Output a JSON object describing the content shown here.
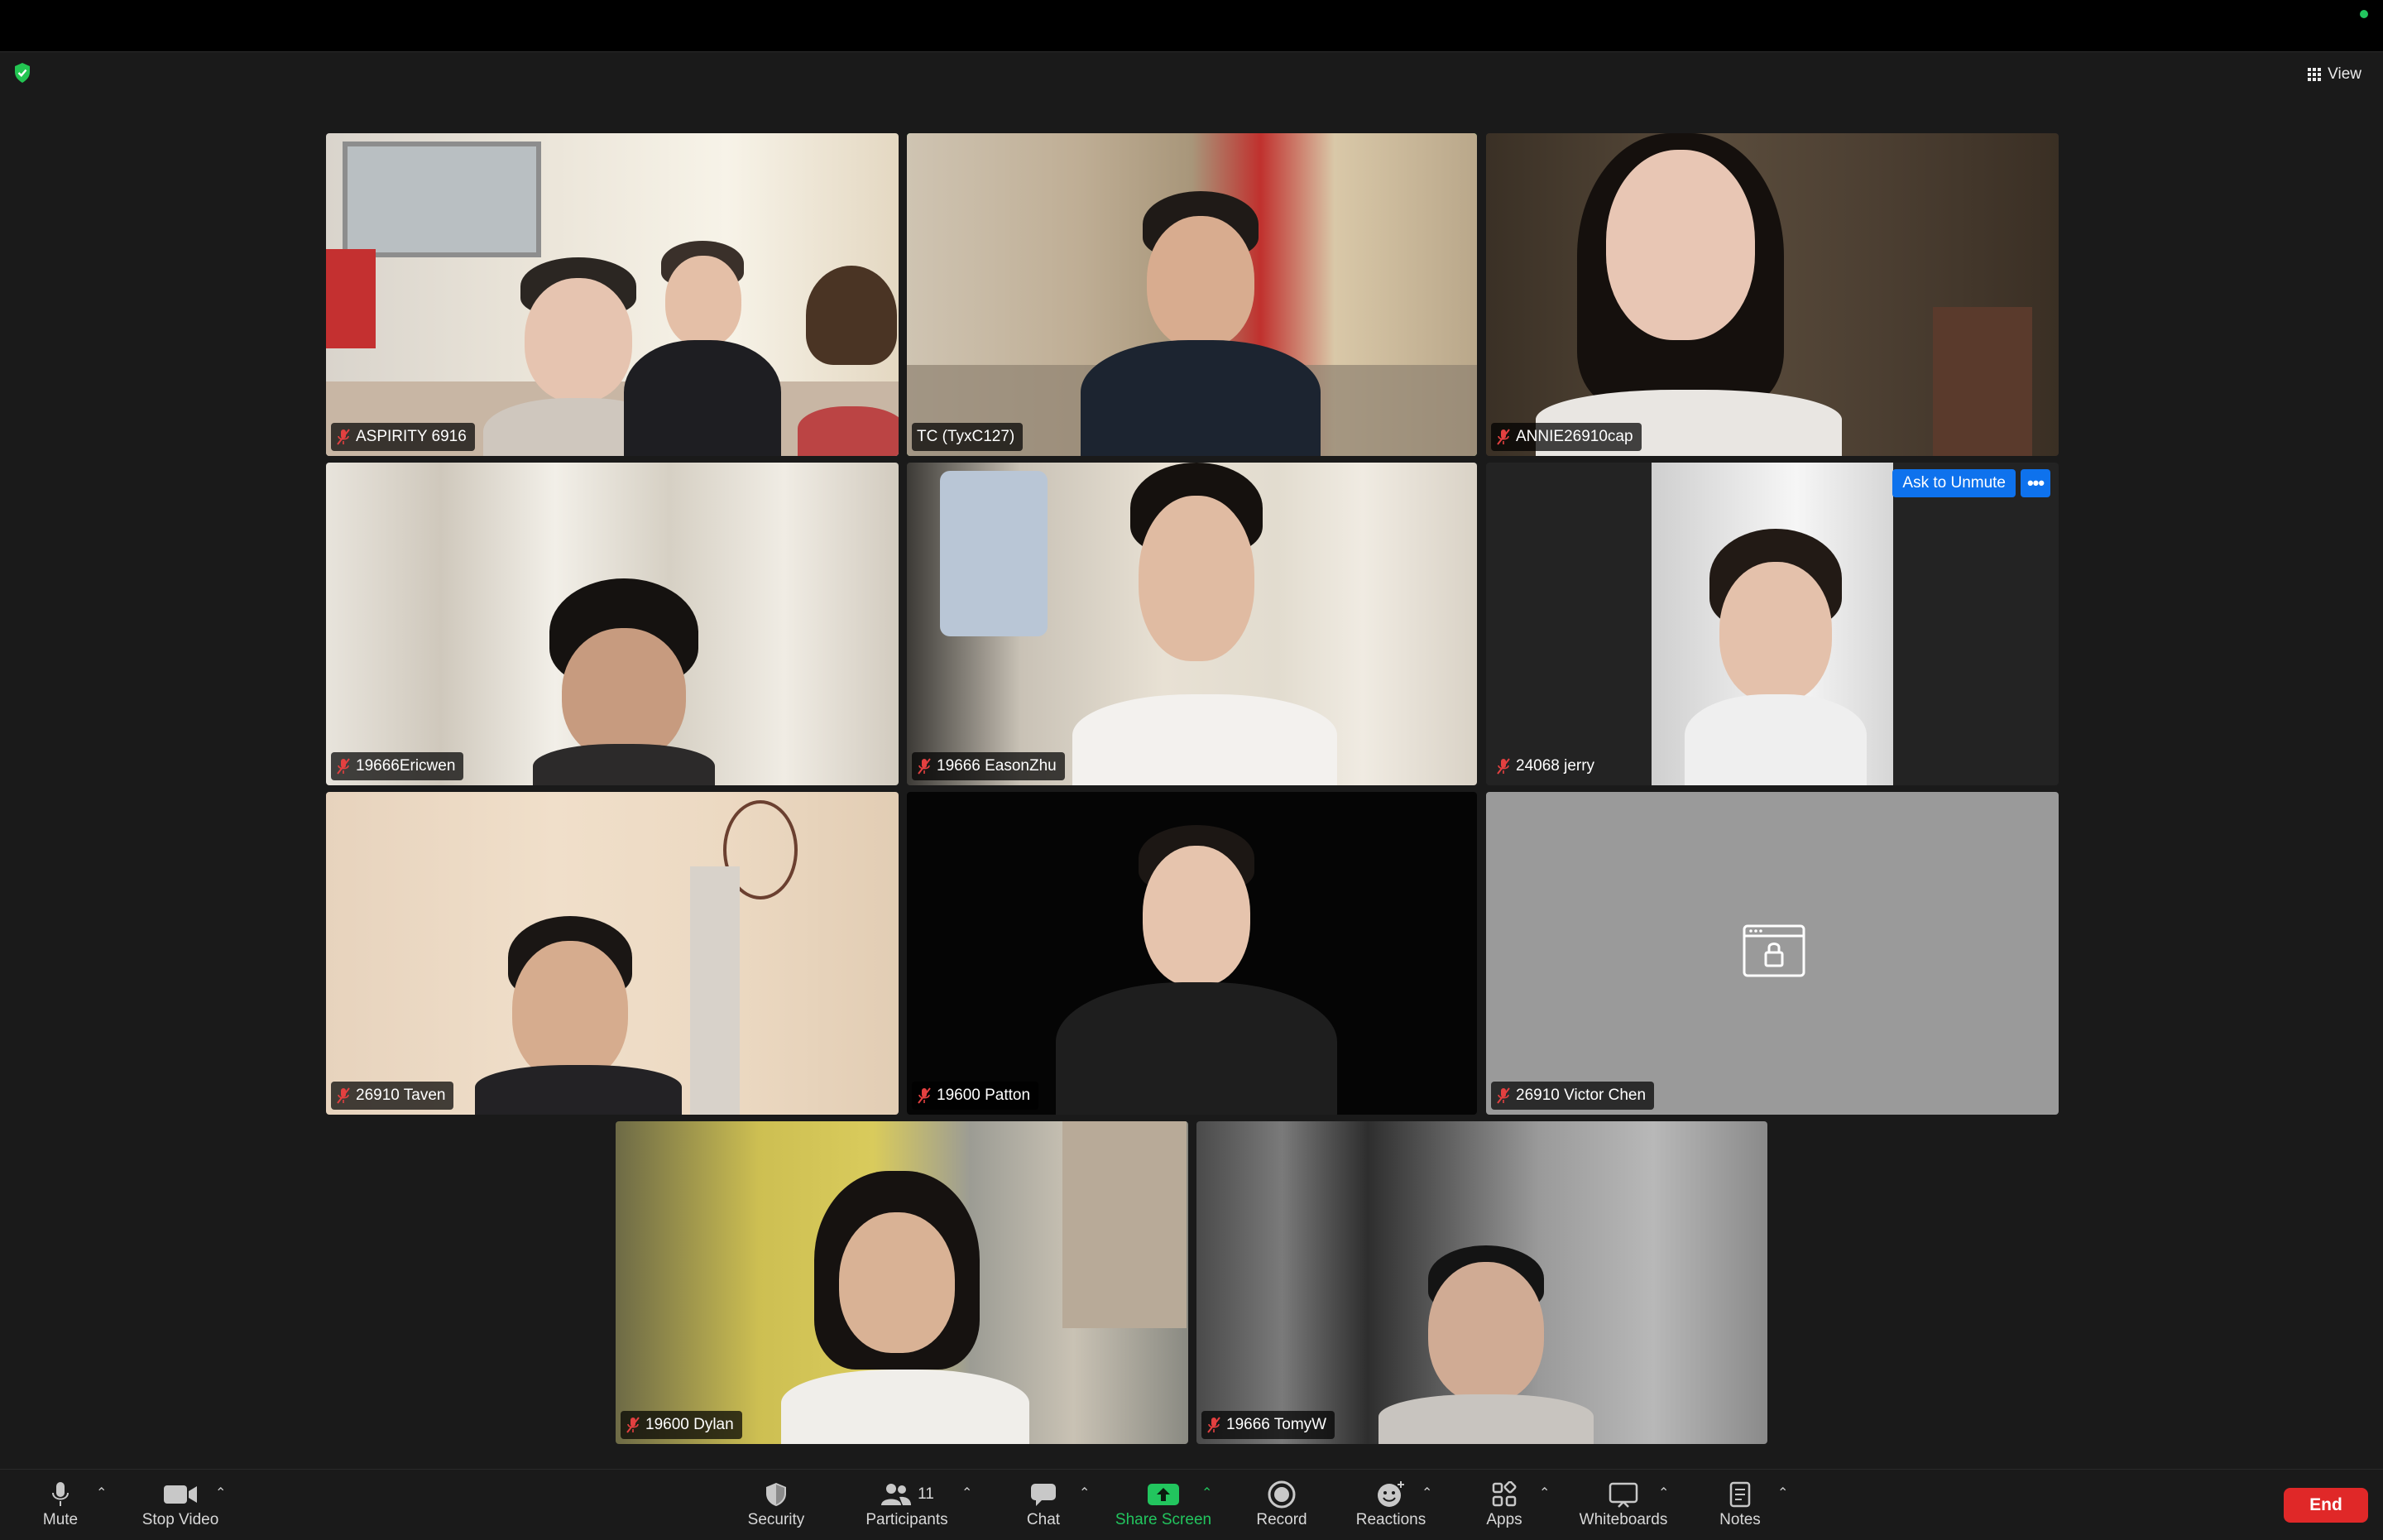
{
  "meeting": {
    "view_label": "View",
    "participants": [
      {
        "name": "ASPIRITY 6916"
      },
      {
        "name": "TC (TyxC127)"
      },
      {
        "name": "ANNIE26910cap"
      },
      {
        "name": "19666Ericwen"
      },
      {
        "name": "19666 EasonZhu"
      },
      {
        "name": "24068 jerry"
      },
      {
        "name": "26910 Taven"
      },
      {
        "name": "19600 Patton"
      },
      {
        "name": "26910 Victor Chen"
      },
      {
        "name": "19600 Dylan"
      },
      {
        "name": "19666 TomyW"
      }
    ],
    "ask_to_unmute_label": "Ask to Unmute",
    "more_label": "•••"
  },
  "toolbar": {
    "mute": "Mute",
    "stop_video": "Stop Video",
    "security": "Security",
    "participants": "Participants",
    "participants_count": "11",
    "chat": "Chat",
    "share_screen": "Share Screen",
    "record": "Record",
    "reactions": "Reactions",
    "apps": "Apps",
    "whiteboards": "Whiteboards",
    "notes": "Notes",
    "end": "End"
  },
  "colors": {
    "active_speaker": "#3ddc5a",
    "share_screen": "#22c55e",
    "end": "#e02828",
    "ask_unmute": "#0e72ed",
    "muted": "#e34040"
  }
}
